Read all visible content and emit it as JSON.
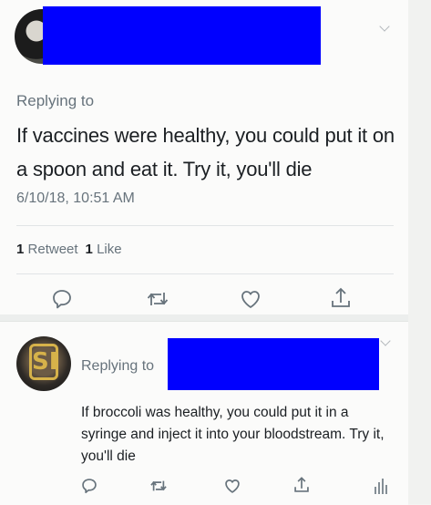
{
  "tweet1": {
    "replying_label": "Replying to",
    "text": "If vaccines were healthy, you could put it on a spoon and eat it. Try it, you'll die",
    "timestamp": "6/10/18, 10:51 AM",
    "retweets": {
      "count": "1",
      "label": "Retweet"
    },
    "likes": {
      "count": "1",
      "label": "Like"
    },
    "actions": [
      "reply-icon",
      "retweet-icon",
      "like-icon",
      "share-icon"
    ]
  },
  "tweet2": {
    "avatar_text": "SI",
    "replying_label": "Replying to",
    "text": "If broccoli was healthy, you could put it in a syringe and inject it into your bloodstream. Try it, you'll die",
    "actions": [
      "reply-icon",
      "retweet-icon",
      "like-icon",
      "share-icon",
      "analytics-icon"
    ]
  },
  "colors": {
    "redaction": "#0000ff",
    "text_primary": "#1b1f23",
    "text_secondary": "#67737c",
    "background": "#fbfbfa"
  }
}
